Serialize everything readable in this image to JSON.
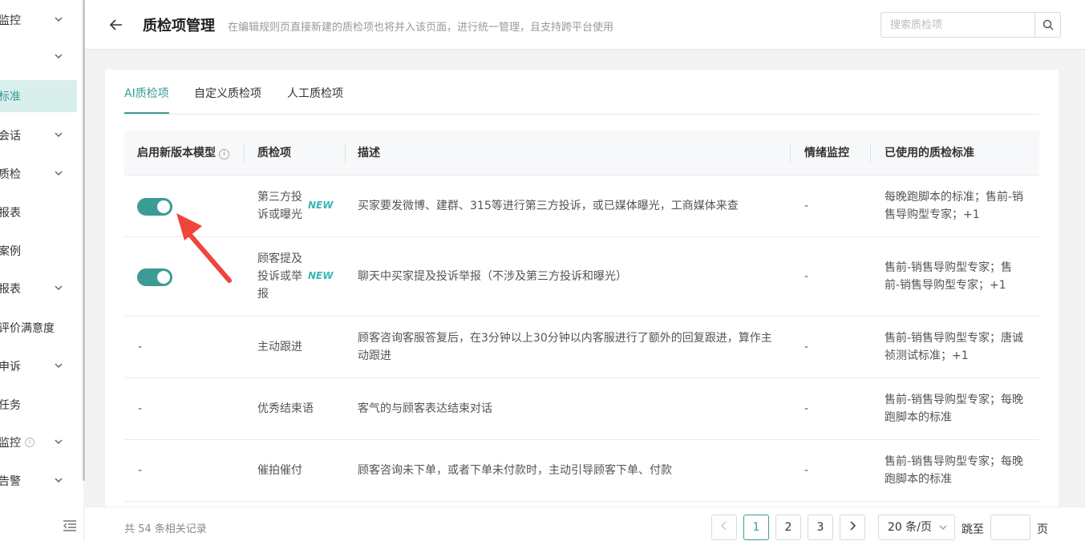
{
  "sidebar": {
    "items": [
      {
        "label": "监控",
        "chevron": true
      },
      {
        "label": "",
        "chevron": true
      },
      {
        "label": "标准",
        "chevron": false,
        "active": true
      },
      {
        "label": "会话",
        "chevron": true
      },
      {
        "label": "质检",
        "chevron": true
      },
      {
        "label": "报表",
        "chevron": false
      },
      {
        "label": "案例",
        "chevron": false
      },
      {
        "label": "报表",
        "chevron": true
      },
      {
        "label": "评价满意度",
        "chevron": false
      },
      {
        "label": "申诉",
        "chevron": true
      },
      {
        "label": "任务",
        "chevron": false
      },
      {
        "label": "监控",
        "chevron": true,
        "info": true
      },
      {
        "label": "告警",
        "chevron": true
      }
    ],
    "info_glyph": "i"
  },
  "header": {
    "title": "质检项管理",
    "description": "在编辑规则页直接新建的质检项也将并入该页面，进行统一管理，且支持跨平台使用",
    "search_placeholder": "搜索质检项"
  },
  "tabs": [
    {
      "label": "AI质检项",
      "active": true
    },
    {
      "label": "自定义质检项",
      "active": false
    },
    {
      "label": "人工质检项",
      "active": false
    }
  ],
  "table": {
    "columns": {
      "model": "启用新版本模型",
      "item": "质检项",
      "desc": "描述",
      "emotion": "情绪监控",
      "standards": "已使用的质检标准"
    },
    "info_glyph": "i",
    "new_label": "NEW",
    "rows": [
      {
        "toggle": true,
        "item_lines": [
          "第三方投",
          "诉或曝光"
        ],
        "is_new": true,
        "desc_lines": [
          "买家要发微博、建群、315等进行第三方投诉，或已媒体曝光，工商媒体来查"
        ],
        "emotion": "-",
        "standard_lines": [
          "每晚跑脚本的标准；售前-销",
          "售导购型专家；+1"
        ]
      },
      {
        "toggle": true,
        "item_lines": [
          "顾客提及",
          "投诉或举",
          "报"
        ],
        "is_new": true,
        "desc_lines": [
          "聊天中买家提及投诉举报（不涉及第三方投诉和曝光）"
        ],
        "emotion": "-",
        "standard_lines": [
          "售前-销售导购型专家；售",
          "前-销售导购型专家；+1"
        ]
      },
      {
        "toggle": false,
        "model_text": "-",
        "item_lines": [
          "主动跟进"
        ],
        "is_new": false,
        "desc_lines": [
          "顾客咨询客服答复后，在3分钟以上30分钟以内客服进行了额外的回复跟进，算作主",
          "动跟进"
        ],
        "emotion": "-",
        "standard_lines": [
          "售前-销售导购型专家；唐诚",
          "祯测试标准；+1"
        ]
      },
      {
        "toggle": false,
        "model_text": "-",
        "item_lines": [
          "优秀结束语"
        ],
        "is_new": false,
        "desc_lines": [
          "客气的与顾客表达结束对话"
        ],
        "emotion": "-",
        "standard_lines": [
          "售前-销售导购型专家；每晚",
          "跑脚本的标准"
        ]
      },
      {
        "toggle": false,
        "model_text": "-",
        "item_lines": [
          "催拍催付"
        ],
        "is_new": false,
        "desc_lines": [
          "顾客咨询未下单，或者下单未付款时，主动引导顾客下单、付款"
        ],
        "emotion": "-",
        "standard_lines": [
          "售前-销售导购型专家；每晚",
          "跑脚本的标准"
        ]
      }
    ]
  },
  "footer": {
    "total": "共 54 条相关记录",
    "pages": [
      "1",
      "2",
      "3"
    ],
    "current_page": "1",
    "page_size": "20 条/页",
    "jump_label": "跳至",
    "page_label": "页"
  },
  "colors": {
    "accent": "#3a9c94",
    "new_badge": "#3ab6b0",
    "annotation_arrow": "#f0453a"
  }
}
